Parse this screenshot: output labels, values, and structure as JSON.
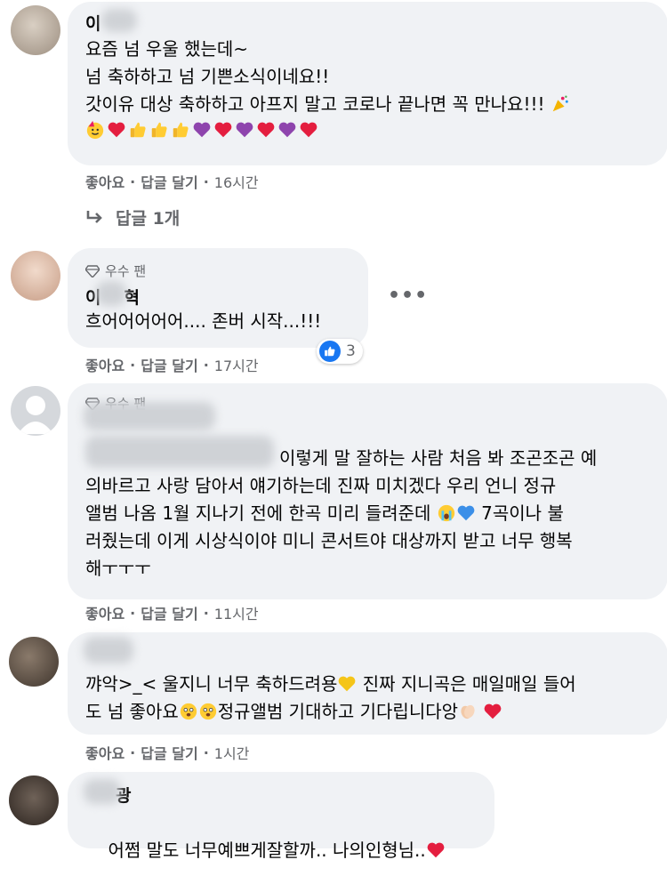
{
  "comments": [
    {
      "name": "이",
      "name_tail": "",
      "lines": [
        "요즘 넘 우울 했는데~",
        "넘 축하하고 넘 기쁜소식이네요!!",
        "갓이유 대상 축하하고 아프지 말고 코로나 끝나면 꼭 만나요!!!"
      ],
      "like": "좋아요",
      "reply": "답글 달기",
      "time": "16시간",
      "replies_label": "답글 1개"
    },
    {
      "badge": "우수 팬",
      "name": "이",
      "name_tail": "혁",
      "lines": [
        "흐어어어어어.... 존버 시작...!!!"
      ],
      "like": "좋아요",
      "reply": "답글 달기",
      "time": "17시간",
      "reactions": "3"
    },
    {
      "badge": "우수 팬",
      "name": "",
      "lines": [
        "이렇게 말 잘하는 사람 처음 봐 조곤조곤 예",
        "의바르고 사랑 담아서 얘기하는데 진짜 미치겠다 우리 언니 정규",
        "앨범 나옴 1월 지나기 전에 한곡 미리 들려준데",
        "7곡이나 불",
        "러줬는데 이게 시상식이야 미니 콘서트야 대상까지 받고 너무 행복",
        "해ㅜㅜㅜ"
      ],
      "like": "좋아요",
      "reply": "답글 달기",
      "time": "11시간"
    },
    {
      "name": "",
      "lines": [
        "꺄악>_< 울지니 너무 축하드려용",
        "진짜 지니곡은 매일매일 들어",
        "도 넘 좋아요",
        "정규앨범 기대하고 기다립니다앙"
      ],
      "like": "좋아요",
      "reply": "답글 달기",
      "time": "1시간"
    },
    {
      "name": "",
      "name_tail": "광",
      "lines": [
        "어쩜 말도 너무예쁘게잘할까.. 나의인형님.."
      ]
    }
  ],
  "colors": {
    "bubble": "#f0f2f5",
    "meta": "#65676b",
    "like_blue": "#1877f2",
    "heart": "#e41e3f"
  }
}
